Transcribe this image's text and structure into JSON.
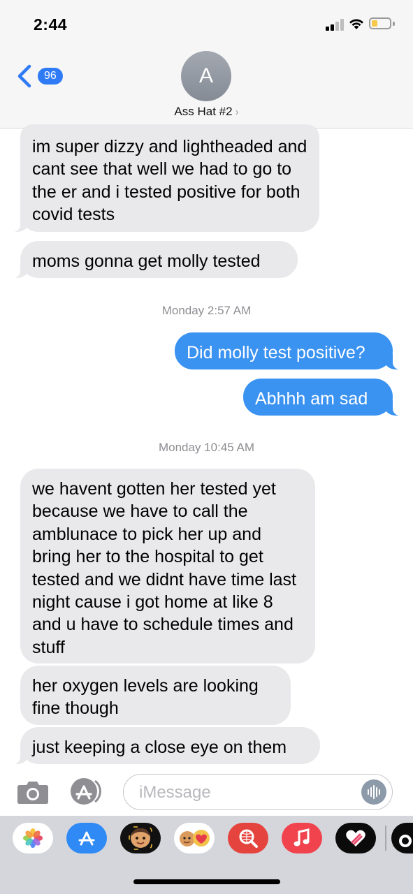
{
  "status_bar": {
    "time": "2:44",
    "battery_color": "#f7c948"
  },
  "header": {
    "back_badge": "96",
    "avatar_initial": "A",
    "contact_name": "Ass Hat #2",
    "chevron": "›"
  },
  "messages": [
    {
      "from": "them",
      "text": "im super dizzy and lightheaded and cant see that well we had to go to the er and i tested positive for both covid tests"
    },
    {
      "from": "them",
      "text": "moms gonna get molly tested"
    },
    {
      "from": "me",
      "text": "Did molly test positive?"
    },
    {
      "from": "me",
      "text": "Abhhh am sad"
    },
    {
      "from": "them",
      "text": "we havent gotten her tested yet because we have to call the amblunace to pick her up and bring her to the hospital to get tested and we didnt have time last night cause i got home at like 8 and u have to schedule times and stuff"
    },
    {
      "from": "them",
      "text": "her oxygen levels are looking fine though"
    },
    {
      "from": "them",
      "text": "just keeping a close eye on them"
    }
  ],
  "timestamps": [
    "Monday 2:57 AM",
    "Monday 10:45 AM"
  ],
  "input": {
    "placeholder": "iMessage"
  },
  "app_drawer": [
    "photos-icon",
    "app-store-icon",
    "memoji-icon",
    "animoji-stickers-icon",
    "web-images-search-icon",
    "music-icon",
    "digital-touch-icon",
    "tiktok-icon"
  ],
  "colors": {
    "outgoing": "#3a92f1",
    "incoming": "#e9e9eb",
    "accent": "#2f7bf6"
  }
}
